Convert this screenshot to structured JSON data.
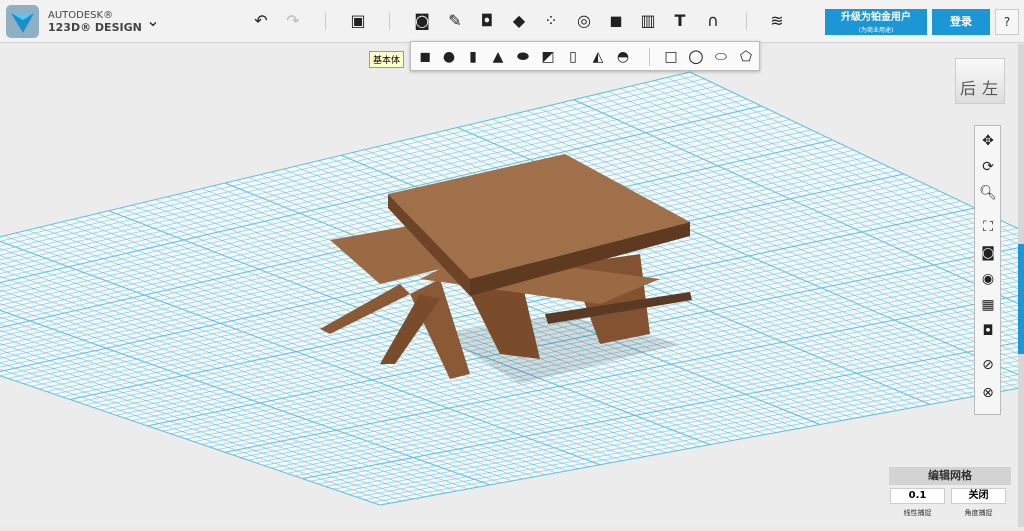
{
  "app": {
    "brand_line1": "AUTODESK®",
    "brand_line2": "123D® DESIGN"
  },
  "toolbar": {
    "tools": [
      "undo-icon",
      "redo-icon",
      "new-object-icon",
      "primitives-icon",
      "sketch-icon",
      "construct-icon",
      "modify-icon",
      "pattern-icon",
      "group-icon",
      "combine-icon",
      "measure-icon",
      "text-icon",
      "snap-icon",
      "material-icon"
    ],
    "upgrade_label": "升级为铂金用户",
    "upgrade_sub": "(为商业用途)",
    "login_label": "登录",
    "help_label": "?"
  },
  "tooltip": "基本体",
  "primitives": [
    "box",
    "sphere",
    "cylinder",
    "cone",
    "torus",
    "wedge",
    "prism",
    "pyramid",
    "hemisphere",
    "rectangle",
    "circle",
    "ellipse",
    "polygon"
  ],
  "viewcube": {
    "face_back": "后",
    "face_left": "左"
  },
  "nav_tools": [
    "pan",
    "orbit",
    "zoom",
    "fit",
    "view-mode",
    "visibility",
    "material-visibility",
    "screenshot",
    "snap-off",
    "edit-off"
  ],
  "grid_panel": {
    "title": "编辑网格",
    "linear_value": "0.1",
    "angular_value": "关闭",
    "linear_label": "线性捕捉",
    "angular_label": "角度捕捉"
  },
  "colors": {
    "accent": "#1c96d4",
    "grid": "#5bbfe0",
    "wood": "#8a5a36"
  }
}
